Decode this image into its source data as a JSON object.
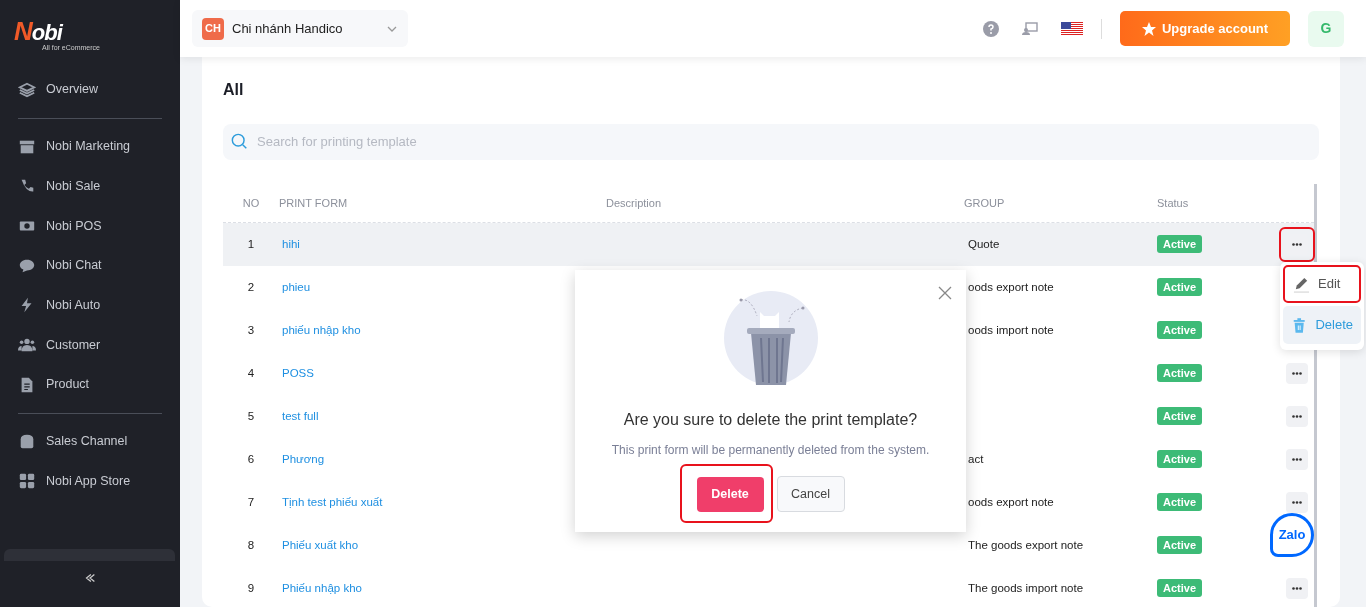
{
  "sidebar": {
    "logo": {
      "text": "Nobi",
      "tagline": "All for eCommerce"
    },
    "sections": [
      {
        "items": [
          {
            "label": "Overview"
          }
        ]
      },
      {
        "items": [
          {
            "label": "Nobi Marketing"
          },
          {
            "label": "Nobi Sale"
          },
          {
            "label": "Nobi POS"
          },
          {
            "label": "Nobi Chat"
          },
          {
            "label": "Nobi Auto"
          },
          {
            "label": "Customer"
          },
          {
            "label": "Product"
          }
        ]
      },
      {
        "items": [
          {
            "label": "Sales Channel"
          },
          {
            "label": "Nobi App Store"
          }
        ]
      }
    ]
  },
  "header": {
    "branch": {
      "initials": "CH",
      "name": "Chi nhánh Handico"
    },
    "upgrade_button": "Upgrade account",
    "avatar": "G"
  },
  "page": {
    "title": "All",
    "search": {
      "placeholder": "Search for printing template"
    },
    "table": {
      "columns": [
        "NO",
        "PRINT FORM",
        "Description",
        "GROUP",
        "Status"
      ],
      "rows": [
        {
          "no": "1",
          "name": "hihi",
          "group": "Quote",
          "status": "Active",
          "selected": true,
          "menu_button": true,
          "highlighted": true
        },
        {
          "no": "2",
          "name": "phieu",
          "group": "oods export note",
          "status": "Active",
          "selected": false,
          "highlighted": false
        },
        {
          "no": "3",
          "name": "phiếu nhập kho",
          "group": "oods import note",
          "status": "Active",
          "selected": false,
          "highlighted": false
        },
        {
          "no": "4",
          "name": "POSS",
          "status": "Active",
          "selected": false,
          "menu_button": true,
          "highlighted": false
        },
        {
          "no": "5",
          "name": "test full",
          "status": "Active",
          "selected": false,
          "menu_button": true,
          "highlighted": false
        },
        {
          "no": "6",
          "name": "Phương",
          "group": "act",
          "status": "Active",
          "selected": false,
          "menu_button": true,
          "highlighted": false
        },
        {
          "no": "7",
          "name": "Tịnh test phiếu xuất",
          "group": "oods export note",
          "status": "Active",
          "selected": false,
          "menu_button": true,
          "highlighted": false
        },
        {
          "no": "8",
          "name": "Phiếu xuất kho",
          "group": "The goods export note",
          "status": "Active",
          "selected": false,
          "highlighted": false
        },
        {
          "no": "9",
          "name": "Phiếu nhập kho",
          "group": "The goods import note",
          "status": "Active",
          "selected": false,
          "menu_button": true,
          "highlighted": false
        }
      ]
    }
  },
  "row_menu": {
    "items": [
      {
        "label": "Edit",
        "selected": false,
        "highlighted": true
      },
      {
        "label": "Delete",
        "selected": true,
        "highlighted": false
      }
    ]
  },
  "dialog": {
    "title": "Are you sure to delete the print template?",
    "message": "This print form will be permanently deleted from the system.",
    "buttons": [
      {
        "label": "Delete",
        "kind": "danger",
        "highlighted": true
      },
      {
        "label": "Cancel",
        "kind": "secondary",
        "highlighted": false
      }
    ]
  },
  "chat_button": {
    "label": "Zalo"
  }
}
